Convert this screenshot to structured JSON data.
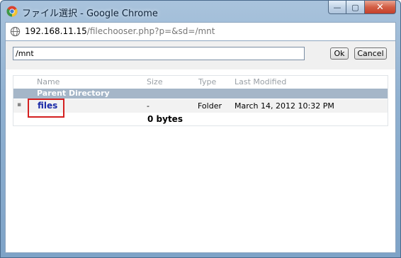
{
  "window": {
    "title": "ファイル選択 - Google Chrome",
    "minimize_label": "—",
    "maximize_label": "▢",
    "close_label": "✕"
  },
  "address": {
    "host": "192.168.11.15",
    "path": "/filechooser.php?p=&sd=/mnt"
  },
  "chooser": {
    "path_value": "/mnt",
    "ok_label": "Ok",
    "cancel_label": "Cancel",
    "columns": [
      "Name",
      "Size",
      "Type",
      "Last Modified"
    ],
    "parent_label": "Parent Directory",
    "rows": [
      {
        "name": "files",
        "size": "-",
        "type": "Folder",
        "modified": "March 14, 2012 10:32 PM"
      }
    ],
    "total": "0 bytes"
  },
  "colors": {
    "parent_row": "#a5b6c8",
    "link": "#1a2aa8",
    "highlight": "#d42020"
  }
}
